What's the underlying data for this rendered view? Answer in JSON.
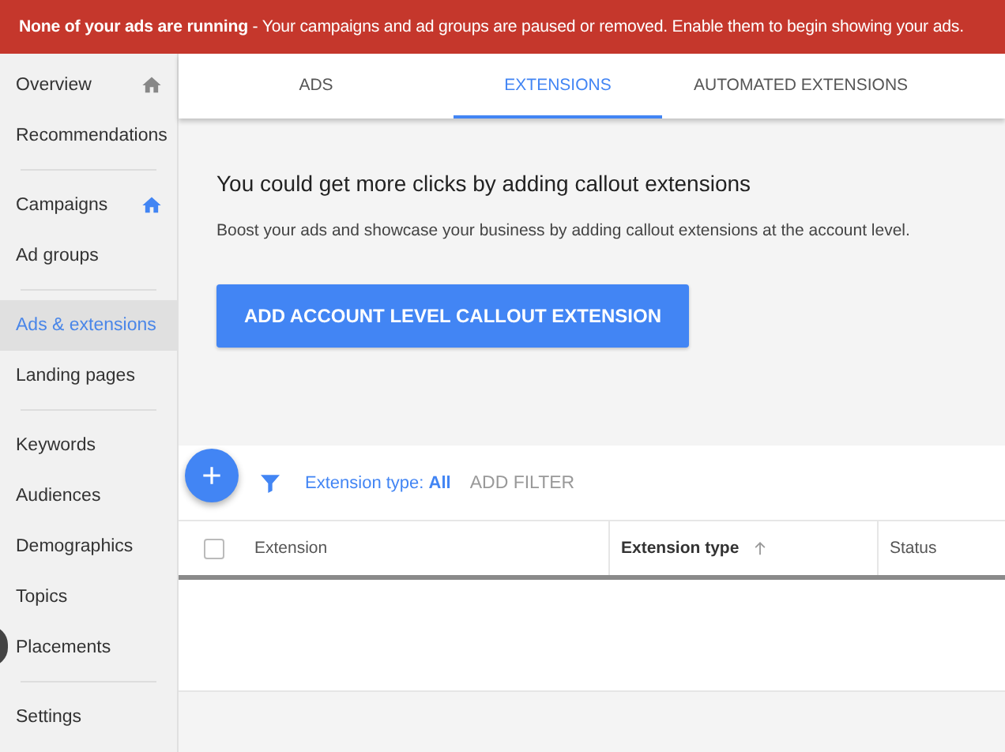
{
  "banner": {
    "text": "**None of your ads are running** - Your campaigns and ad groups are paused or removed. Enable them to begin showing your ads."
  },
  "sidebar": {
    "groups": [
      [
        {
          "label": "Overview",
          "selected": false,
          "home_icon": {
            "highlighted": false
          }
        },
        {
          "label": "Recommendations",
          "selected": false
        }
      ],
      [
        {
          "label": "Campaigns",
          "selected": false,
          "home_icon": {
            "highlighted": true
          }
        },
        {
          "label": "Ad groups",
          "selected": false
        }
      ],
      [
        {
          "label": "Ads & extensions",
          "selected": true
        },
        {
          "label": "Landing pages",
          "selected": false
        }
      ],
      [
        {
          "label": "Keywords",
          "selected": false
        },
        {
          "label": "Audiences",
          "selected": false
        },
        {
          "label": "Demographics",
          "selected": false
        },
        {
          "label": "Topics",
          "selected": false
        },
        {
          "label": "Placements",
          "selected": false
        }
      ],
      [
        {
          "label": "Settings",
          "selected": false
        }
      ]
    ]
  },
  "tabs": [
    {
      "label": "ADS",
      "selected": false
    },
    {
      "label": "EXTENSIONS",
      "selected": true
    },
    {
      "label": "AUTOMATED EXTENSIONS",
      "selected": false
    }
  ],
  "promo": {
    "title": "You could get more clicks by adding callout extensions",
    "description": "Boost your ads and showcase your business by adding callout extensions at the account level.",
    "button": "ADD ACCOUNT LEVEL CALLOUT EXTENSION"
  },
  "toolbar": {
    "filter": "Extension type: **All**",
    "add_filter": "ADD FILTER"
  },
  "table": {
    "select_all": {
      "checked": false
    },
    "columns": [
      {
        "label": "Extension",
        "sorted": false
      },
      {
        "label": "Extension type",
        "sorted": true
      },
      {
        "label": "Status",
        "sorted": false
      }
    ]
  }
}
